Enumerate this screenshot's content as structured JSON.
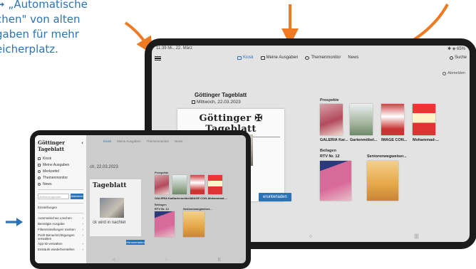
{
  "callout": {
    "line1_arrow": "➞",
    "line1": " „Automatische",
    "line2": "chen\" von alten",
    "line3": "gaben für mehr",
    "line4": "eicherplatz."
  },
  "colors": {
    "accent": "#2b73b8",
    "callout_arrow": "#f07a22",
    "device": "#1b1b1b"
  },
  "big_tablet": {
    "status_time": "11:39  Mi., 22. März",
    "status_right": "✱ ◈ 65%",
    "menu_icon": "hamburger-icon",
    "tabs": [
      {
        "label": "Kiosk",
        "icon": "kiosk-icon",
        "active": true
      },
      {
        "label": "Meine Ausgaben",
        "icon": "folder-icon",
        "active": false
      },
      {
        "label": "Themenmonitor",
        "icon": "monitor-icon",
        "active": false
      },
      {
        "label": "News",
        "icon": "news-icon",
        "active": false
      }
    ],
    "search_label": "Suche",
    "logout_label": "Abmelden",
    "paper": {
      "title": "Göttinger Tageblatt",
      "date": "Mittwoch, 22.03.2023",
      "masthead": "Göttinger ✠ Tageblatt",
      "download_label": "erunterladen"
    },
    "prospekte": {
      "label": "Prospekte",
      "items": [
        "GALERIA Kar...",
        "Gartenmöbel...",
        "IMAGE CON...",
        "Mohammad-..."
      ]
    },
    "beilagen": {
      "label": "Beilagen",
      "items": [
        "RTV Nr. 12",
        "Seniorenwegweiser..."
      ]
    },
    "nav": [
      "◁",
      "○",
      "|||"
    ]
  },
  "small_tablet": {
    "logo": "Göttinger Tageblatt",
    "close_icon": "‹",
    "drawer_items": [
      {
        "label": "Kiosk",
        "icon": "kiosk-icon"
      },
      {
        "label": "Meine Ausgaben",
        "icon": "folder-icon"
      },
      {
        "label": "Merkzettel",
        "icon": "star-icon"
      },
      {
        "label": "Themenmonitor",
        "icon": "monitor-icon"
      },
      {
        "label": "News",
        "icon": "news-icon"
      }
    ],
    "activate_placeholder": "Aktivierungscode",
    "activate_button": "Aktivieren",
    "settings_label": "Einstellungen",
    "settings_items": [
      "Automatisches Löschen",
      "Benötigte Ausgabe",
      "Filtereinstellungen merken",
      "Push-Benachrichtigungen verwalten",
      "App-ID verwalten",
      "Einkäufe wiederherstellen"
    ],
    "tabs": [
      "Kiosk",
      "Meine Ausgaben",
      "Themenmonitor",
      "News"
    ],
    "date": "ch, 22.03.2023",
    "masthead": "Tageblatt",
    "paper_text": "ck wird in\nnachtet",
    "download_label": "Herunterladen",
    "prospekte": {
      "label": "Prospekte",
      "items": [
        "GALERIA Kar...",
        "Gartenmöbel...",
        "IMAGE CON...",
        "Mohammad-..."
      ]
    },
    "beilagen": {
      "label": "Beilagen",
      "items": [
        "RTV Nr. 12",
        "Seniorenwegweiser..."
      ]
    },
    "nav": [
      "◁",
      "○",
      "|||"
    ]
  }
}
